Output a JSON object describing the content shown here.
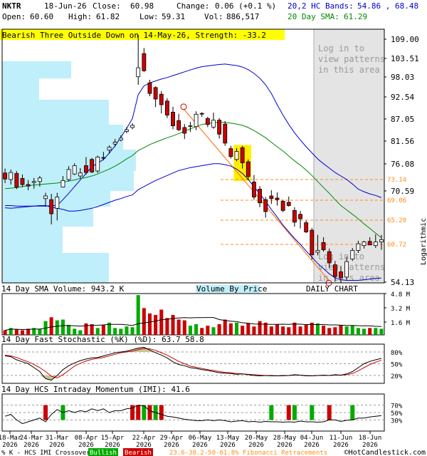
{
  "header": {
    "symbol": "NKTR",
    "date": "18-Jun-26",
    "close_label": "Close:",
    "close": "60.98",
    "change_label": "Change:",
    "change": "0.06 (+0.1 %)",
    "open_label": "Open:",
    "open": "60.60",
    "high_label": "High:",
    "high": "61.82",
    "low_label": "Low:",
    "low": "59.31",
    "vol_label": "Vol:",
    "vol": "886,517",
    "bands_label": "20,2 HC Bands:",
    "bands": "54.86 , 68.48",
    "sma_label": "20 Day SMA:",
    "sma": "61.29"
  },
  "colors": {
    "up": "#00aa00",
    "down": "#cc0000",
    "band": "#0000cc",
    "sma": "#008800",
    "vbp": "#bfeffa",
    "shade": "#e4e4e4",
    "fib": "#ff8c1a",
    "banner": "#ffff00",
    "stoch_fill": "#c8c496"
  },
  "pattern_banner": "Bearish Three Outside Down on 14-May-26, Strength: -33.2",
  "login_text": [
    "Log in to",
    "view patterns",
    "in this area"
  ],
  "panel_labels": {
    "volume": "14 Day SMA Volume: 943.2 K",
    "vbp": "Volume By Price",
    "daily": "DAILY CHART",
    "stoch": "14 Day Fast Stochastic (%K) (%D): 63.7   58.8",
    "imi": "14 Day HCS Intraday Momentum (IMI): 41.6",
    "logarithmic": "Logarithmic"
  },
  "footer": {
    "legend": "% K - HCS IMI Crossover,",
    "bullish": "Bullish",
    "bearish": "Bearish",
    "fib": "23.6-38.2-50-61.8% Fibonacci Retracements",
    "copyright": "©HotCandlestick.com"
  },
  "chart_data": {
    "type": "candlestick",
    "price_axis": {
      "scale": "log",
      "range": [
        54.13,
        109.0
      ],
      "ticks": [
        "109.00",
        "103.51",
        "98.03",
        "92.54",
        "87.05",
        "81.56",
        "76.08",
        "70.59",
        "65.20",
        "54.13"
      ]
    },
    "fib_levels": [
      "73.14",
      "69.06",
      "65.20",
      "60.72"
    ],
    "x_labels": [
      [
        "18-Mar",
        "2026"
      ],
      [
        "24-Mar",
        "2026"
      ],
      [
        "31-Mar",
        "2026"
      ],
      [
        "08-Apr",
        "2026"
      ],
      [
        "15-Apr",
        "2026"
      ],
      [
        "22-Apr",
        "2026"
      ],
      [
        "29-Apr",
        "2026"
      ],
      [
        "06-May",
        "2026"
      ],
      [
        "13-May",
        "2026"
      ],
      [
        "20-May",
        "2026"
      ],
      [
        "28-May",
        "2026"
      ],
      [
        "04-Jun",
        "2026"
      ],
      [
        "11-Jun",
        "2026"
      ],
      [
        "18-Jun",
        "2026"
      ]
    ],
    "volume_ticks": [
      "4.8 M",
      "3.2 M",
      "1.6 M"
    ],
    "stoch_ticks": [
      "80%",
      "50%",
      "20%"
    ],
    "imi_ticks": [
      "70%",
      "50%",
      "30%"
    ],
    "candles": [
      {
        "d": "18-Mar",
        "o": 73.3,
        "h": 74.2,
        "l": 71.3,
        "c": 72.1
      },
      {
        "d": "19-Mar",
        "o": 72.0,
        "h": 74.0,
        "l": 71.0,
        "c": 73.4
      },
      {
        "d": "20-Mar",
        "o": 73.2,
        "h": 73.7,
        "l": 70.1,
        "c": 70.5
      },
      {
        "d": "23-Mar",
        "o": 72.2,
        "h": 73.0,
        "l": 70.5,
        "c": 71.0
      },
      {
        "d": "24-Mar",
        "o": 71.0,
        "h": 71.9,
        "l": 69.9,
        "c": 70.7
      },
      {
        "d": "25-Mar",
        "o": 71.4,
        "h": 72.3,
        "l": 70.2,
        "c": 71.6
      },
      {
        "d": "26-Mar",
        "o": 71.6,
        "h": 72.7,
        "l": 70.6,
        "c": 72.3
      },
      {
        "d": "27-Mar",
        "o": 68.3,
        "h": 69.4,
        "l": 66.8,
        "c": 68.8
      },
      {
        "d": "30-Mar",
        "o": 68.1,
        "h": 69.2,
        "l": 63.6,
        "c": 65.5
      },
      {
        "d": "31-Mar",
        "o": 66.5,
        "h": 69.4,
        "l": 64.3,
        "c": 68.6
      },
      {
        "d": "01-Apr",
        "o": 70.5,
        "h": 72.7,
        "l": 70.4,
        "c": 71.8
      },
      {
        "d": "02-Apr",
        "o": 72.0,
        "h": 74.7,
        "l": 71.6,
        "c": 74.0
      },
      {
        "d": "03-Apr",
        "o": 73.1,
        "h": 75.3,
        "l": 72.9,
        "c": 74.8
      },
      {
        "d": "06-Apr",
        "o": 72.7,
        "h": 74.3,
        "l": 72.2,
        "c": 73.3
      },
      {
        "d": "07-Apr",
        "o": 74.8,
        "h": 76.6,
        "l": 73.0,
        "c": 73.4
      },
      {
        "d": "08-Apr",
        "o": 76.1,
        "h": 76.4,
        "l": 73.3,
        "c": 73.5
      },
      {
        "d": "09-Apr",
        "o": 73.7,
        "h": 76.9,
        "l": 73.3,
        "c": 76.6
      },
      {
        "d": "10-Apr",
        "o": 76.5,
        "h": 77.7,
        "l": 75.9,
        "c": 76.4
      },
      {
        "d": "13-Apr",
        "o": 78.1,
        "h": 79.1,
        "l": 77.3,
        "c": 78.7
      },
      {
        "d": "14-Apr",
        "o": 79.4,
        "h": 80.5,
        "l": 78.8,
        "c": 79.8
      },
      {
        "d": "15-Apr",
        "o": 80.3,
        "h": 81.3,
        "l": 80.0,
        "c": 80.7
      },
      {
        "d": "16-Apr",
        "o": 82.2,
        "h": 83.2,
        "l": 81.8,
        "c": 82.6
      },
      {
        "d": "17-Apr",
        "o": 83.1,
        "h": 84.1,
        "l": 82.7,
        "c": 83.6
      },
      {
        "d": "20-Apr",
        "o": 95.6,
        "h": 107.3,
        "l": 93.5,
        "c": 98.0
      },
      {
        "d": "21-Apr",
        "o": 101.9,
        "h": 103.5,
        "l": 96.9,
        "c": 97.2
      },
      {
        "d": "22-Apr",
        "o": 94.0,
        "h": 94.8,
        "l": 90.6,
        "c": 91.3
      },
      {
        "d": "23-Apr",
        "o": 92.8,
        "h": 93.1,
        "l": 87.9,
        "c": 89.9
      },
      {
        "d": "24-Apr",
        "o": 91.1,
        "h": 91.9,
        "l": 86.4,
        "c": 88.5
      },
      {
        "d": "27-Apr",
        "o": 89.4,
        "h": 90.1,
        "l": 85.3,
        "c": 86.0
      },
      {
        "d": "28-Apr",
        "o": 86.7,
        "h": 88.0,
        "l": 82.7,
        "c": 83.5
      },
      {
        "d": "29-Apr",
        "o": 84.7,
        "h": 86.3,
        "l": 82.3,
        "c": 82.6
      },
      {
        "d": "30-Apr",
        "o": 83.1,
        "h": 83.9,
        "l": 80.5,
        "c": 81.8
      },
      {
        "d": "01-May",
        "o": 83.4,
        "h": 84.4,
        "l": 82.1,
        "c": 83.5
      },
      {
        "d": "04-May",
        "o": 83.3,
        "h": 86.9,
        "l": 82.5,
        "c": 86.2
      },
      {
        "d": "05-May",
        "o": 86.4,
        "h": 86.7,
        "l": 85.6,
        "c": 86.3
      },
      {
        "d": "06-May",
        "o": 85.2,
        "h": 85.6,
        "l": 83.2,
        "c": 83.8
      },
      {
        "d": "07-May",
        "o": 83.2,
        "h": 86.6,
        "l": 82.8,
        "c": 84.8
      },
      {
        "d": "08-May",
        "o": 84.8,
        "h": 85.3,
        "l": 80.6,
        "c": 81.6
      },
      {
        "d": "11-May",
        "o": 83.9,
        "h": 84.6,
        "l": 79.0,
        "c": 79.6
      },
      {
        "d": "12-May",
        "o": 78.4,
        "h": 79.0,
        "l": 76.3,
        "c": 76.7
      },
      {
        "d": "13-May",
        "o": 76.1,
        "h": 78.5,
        "l": 75.7,
        "c": 77.8
      },
      {
        "d": "14-May",
        "o": 78.6,
        "h": 79.0,
        "l": 74.2,
        "c": 75.4
      },
      {
        "d": "15-May",
        "o": 75.6,
        "h": 76.1,
        "l": 71.9,
        "c": 72.6
      },
      {
        "d": "18-May",
        "o": 71.5,
        "h": 72.9,
        "l": 68.1,
        "c": 68.6
      },
      {
        "d": "19-May",
        "o": 70.1,
        "h": 70.7,
        "l": 66.7,
        "c": 67.5
      },
      {
        "d": "20-May",
        "o": 68.1,
        "h": 68.6,
        "l": 64.8,
        "c": 65.9
      },
      {
        "d": "21-May",
        "o": 68.8,
        "h": 69.9,
        "l": 67.3,
        "c": 68.3
      },
      {
        "d": "22-May",
        "o": 68.4,
        "h": 69.5,
        "l": 67.0,
        "c": 68.1
      },
      {
        "d": "26-May",
        "o": 67.8,
        "h": 68.1,
        "l": 65.8,
        "c": 66.1
      },
      {
        "d": "27-May",
        "o": 67.6,
        "h": 68.7,
        "l": 66.8,
        "c": 67.0
      },
      {
        "d": "28-May",
        "o": 66.1,
        "h": 66.7,
        "l": 63.2,
        "c": 64.0
      },
      {
        "d": "29-May",
        "o": 65.4,
        "h": 66.0,
        "l": 62.9,
        "c": 64.6
      },
      {
        "d": "01-Jun",
        "o": 63.9,
        "h": 64.3,
        "l": 62.1,
        "c": 62.3
      },
      {
        "d": "02-Jun",
        "o": 62.6,
        "h": 63.0,
        "l": 57.7,
        "c": 58.5
      },
      {
        "d": "03-Jun",
        "o": 58.9,
        "h": 61.8,
        "l": 58.4,
        "c": 59.2
      },
      {
        "d": "04-Jun",
        "o": 60.5,
        "h": 61.4,
        "l": 59.0,
        "c": 59.3
      },
      {
        "d": "05-Jun",
        "o": 59.0,
        "h": 59.5,
        "l": 56.4,
        "c": 57.2
      },
      {
        "d": "08-Jun",
        "o": 56.9,
        "h": 57.5,
        "l": 54.3,
        "c": 55.1
      },
      {
        "d": "09-Jun",
        "o": 55.8,
        "h": 56.7,
        "l": 54.1,
        "c": 54.9
      },
      {
        "d": "10-Jun",
        "o": 55.0,
        "h": 58.2,
        "l": 54.6,
        "c": 57.4
      },
      {
        "d": "11-Jun",
        "o": 57.8,
        "h": 59.6,
        "l": 57.5,
        "c": 59.2
      },
      {
        "d": "12-Jun",
        "o": 59.2,
        "h": 60.8,
        "l": 58.8,
        "c": 60.3
      },
      {
        "d": "15-Jun",
        "o": 60.0,
        "h": 60.8,
        "l": 59.5,
        "c": 60.6
      },
      {
        "d": "16-Jun",
        "o": 60.7,
        "h": 61.4,
        "l": 60.1,
        "c": 60.1
      },
      {
        "d": "17-Jun",
        "o": 60.0,
        "h": 61.9,
        "l": 59.6,
        "c": 60.6
      },
      {
        "d": "18-Jun",
        "o": 60.6,
        "h": 61.8,
        "l": 59.3,
        "c": 60.98
      }
    ],
    "upper_band": [
      67.0,
      67.0,
      66.9,
      66.9,
      66.9,
      66.9,
      66.9,
      66.9,
      67.0,
      67.0,
      68.1,
      69.3,
      70.6,
      71.9,
      73.2,
      74.6,
      75.3,
      76.1,
      77.4,
      79.0,
      80.9,
      82.9,
      85.2,
      91.0,
      93.2,
      94.0,
      94.5,
      95.0,
      95.4,
      95.9,
      96.4,
      96.9,
      97.4,
      97.9,
      98.3,
      98.5,
      98.7,
      98.9,
      99.0,
      98.8,
      98.6,
      98.2,
      97.5,
      96.5,
      95.2,
      93.5,
      91.3,
      88.5,
      86.0,
      83.8,
      81.9,
      80.3,
      78.8,
      77.5,
      76.2,
      75.2,
      74.3,
      73.4,
      72.7,
      72.0,
      71.1,
      70.1,
      69.6,
      69.2,
      68.9,
      68.48
    ],
    "sma20": [
      70.2,
      70.3,
      70.4,
      70.6,
      70.8,
      70.9,
      71.0,
      71.1,
      71.2,
      71.3,
      71.5,
      71.7,
      71.9,
      72.2,
      72.4,
      72.7,
      73.1,
      73.6,
      74.1,
      74.7,
      75.4,
      76.2,
      76.9,
      78.0,
      78.6,
      79.3,
      79.8,
      80.3,
      80.8,
      81.2,
      81.7,
      82.3,
      82.8,
      83.3,
      83.8,
      84.0,
      84.2,
      84.3,
      84.3,
      84.1,
      83.9,
      83.6,
      83.1,
      82.4,
      81.6,
      80.8,
      79.8,
      78.8,
      77.9,
      76.8,
      75.8,
      74.9,
      73.9,
      72.8,
      71.6,
      70.4,
      69.3,
      68.1,
      67.0,
      66.2,
      65.4,
      64.6,
      63.7,
      62.9,
      62.1,
      61.29
    ],
    "lower_band": [
      66.6,
      66.5,
      66.6,
      66.7,
      66.8,
      66.9,
      67.0,
      67.0,
      66.7,
      66.5,
      66.3,
      66.0,
      66.0,
      66.1,
      66.3,
      66.5,
      66.8,
      67.2,
      67.6,
      68.0,
      68.3,
      68.7,
      69.0,
      70.0,
      70.6,
      71.2,
      71.8,
      72.3,
      72.8,
      73.3,
      73.8,
      74.1,
      74.4,
      74.6,
      74.8,
      75.0,
      75.2,
      75.2,
      75.0,
      74.7,
      74.1,
      73.2,
      72.0,
      70.6,
      69.2,
      67.8,
      66.3,
      64.9,
      63.5,
      62.3,
      61.2,
      60.2,
      59.1,
      58.1,
      57.1,
      56.3,
      55.5,
      54.9,
      54.6,
      54.5,
      54.5,
      54.5,
      54.6,
      54.7,
      54.8,
      54.86
    ],
    "volume": [
      0.6,
      0.9,
      0.7,
      0.6,
      0.8,
      0.9,
      0.8,
      1.8,
      2.3,
      1.9,
      2.0,
      1.3,
      0.8,
      0.6,
      1.5,
      1.4,
      0.9,
      1.3,
      1.6,
      0.9,
      0.8,
      1.1,
      1.0,
      5.2,
      3.5,
      2.8,
      2.6,
      3.3,
      2.2,
      2.6,
      2.0,
      1.9,
      1.2,
      1.4,
      0.9,
      1.2,
      1.0,
      1.4,
      2.0,
      1.5,
      1.6,
      1.2,
      1.5,
      1.1,
      1.8,
      1.6,
      1.1,
      1.4,
      1.1,
      1.0,
      1.6,
      1.1,
      1.3,
      1.6,
      1.5,
      1.2,
      0.9,
      1.0,
      1.3,
      1.1,
      1.2,
      0.9,
      0.8,
      0.9,
      0.9,
      0.8
    ],
    "stoch_k": [
      70,
      68,
      60,
      55,
      50,
      40,
      30,
      12,
      8,
      20,
      35,
      45,
      52,
      58,
      62,
      65,
      66,
      70,
      74,
      78,
      80,
      82,
      86,
      90,
      92,
      85,
      78,
      72,
      65,
      55,
      48,
      45,
      40,
      38,
      35,
      33,
      30,
      27,
      26,
      25,
      23,
      24,
      22,
      20,
      19,
      20,
      19,
      19,
      20,
      20,
      22,
      21,
      19,
      19,
      20,
      21,
      20,
      22,
      21,
      24,
      30,
      40,
      50,
      56,
      60,
      63.7
    ],
    "stoch_d": [
      72,
      70,
      66,
      60,
      55,
      48,
      40,
      30,
      18,
      14,
      22,
      33,
      44,
      51,
      57,
      61,
      64,
      66,
      70,
      74,
      78,
      80,
      82,
      86,
      89,
      88,
      84,
      78,
      72,
      64,
      56,
      50,
      44,
      41,
      38,
      35,
      33,
      30,
      28,
      27,
      25,
      24,
      23,
      22,
      21,
      20,
      20,
      19,
      19,
      20,
      21,
      21,
      20,
      19,
      20,
      20,
      20,
      21,
      21,
      22,
      25,
      32,
      40,
      48,
      54,
      58.8
    ],
    "imi": [
      40,
      45,
      30,
      20,
      25,
      30,
      35,
      25,
      45,
      58,
      50,
      55,
      50,
      55,
      52,
      60,
      55,
      60,
      50,
      55,
      55,
      60,
      62,
      70,
      68,
      55,
      50,
      45,
      40,
      38,
      35,
      32,
      30,
      28,
      28,
      30,
      28,
      30,
      28,
      25,
      27,
      28,
      25,
      26,
      24,
      26,
      25,
      25,
      24,
      25,
      24,
      27,
      25,
      25,
      24,
      25,
      30,
      30,
      26,
      29,
      30,
      35,
      35,
      38,
      40,
      41.6
    ],
    "imi_signals": [
      {
        "i": 7,
        "type": "bearish"
      },
      {
        "i": 10,
        "type": "bullish"
      },
      {
        "i": 22,
        "type": "bearish"
      },
      {
        "i": 23,
        "type": "bearish"
      },
      {
        "i": 24,
        "type": "bullish"
      },
      {
        "i": 25,
        "type": "bearish"
      },
      {
        "i": 26,
        "type": "bullish"
      },
      {
        "i": 27,
        "type": "bearish"
      },
      {
        "i": 46,
        "type": "bullish"
      },
      {
        "i": 49,
        "type": "bearish"
      },
      {
        "i": 50,
        "type": "bullish"
      },
      {
        "i": 53,
        "type": "bullish"
      },
      {
        "i": 56,
        "type": "bearish"
      },
      {
        "i": 60,
        "type": "bullish"
      }
    ]
  }
}
